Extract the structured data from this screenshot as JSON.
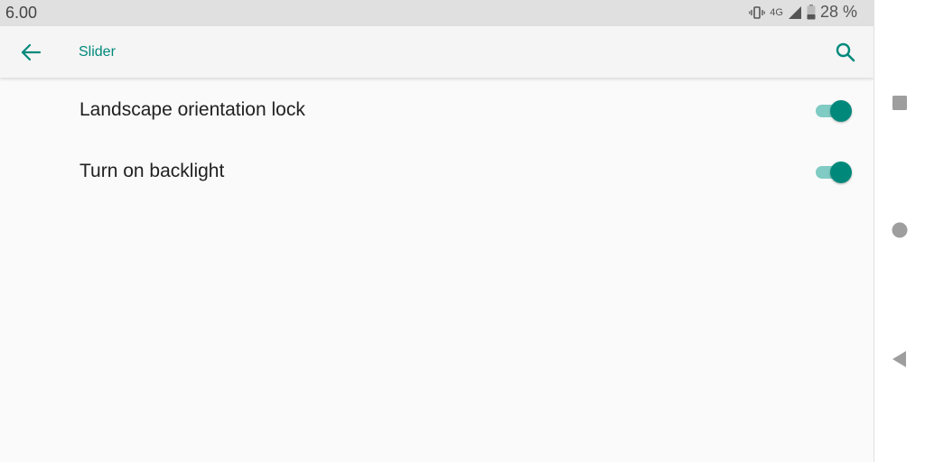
{
  "status_bar": {
    "time": "6.00",
    "network": "4G",
    "battery_percent": "28 %",
    "icons": [
      "vibrate-icon",
      "signal-icon",
      "battery-icon"
    ]
  },
  "app_bar": {
    "title": "Slider",
    "back_icon": "arrow-back-icon",
    "search_icon": "search-icon"
  },
  "settings": [
    {
      "label": "Landscape orientation lock",
      "enabled": true
    },
    {
      "label": "Turn on backlight",
      "enabled": true
    }
  ],
  "nav_bar": {
    "buttons": [
      "recents-icon",
      "home-icon",
      "back-icon"
    ]
  },
  "colors": {
    "accent": "#00897b",
    "accent_light": "#80cbc4",
    "status_bar_bg": "#e0e0e0",
    "app_bar_bg": "#f5f5f5",
    "background": "#fafafa"
  }
}
